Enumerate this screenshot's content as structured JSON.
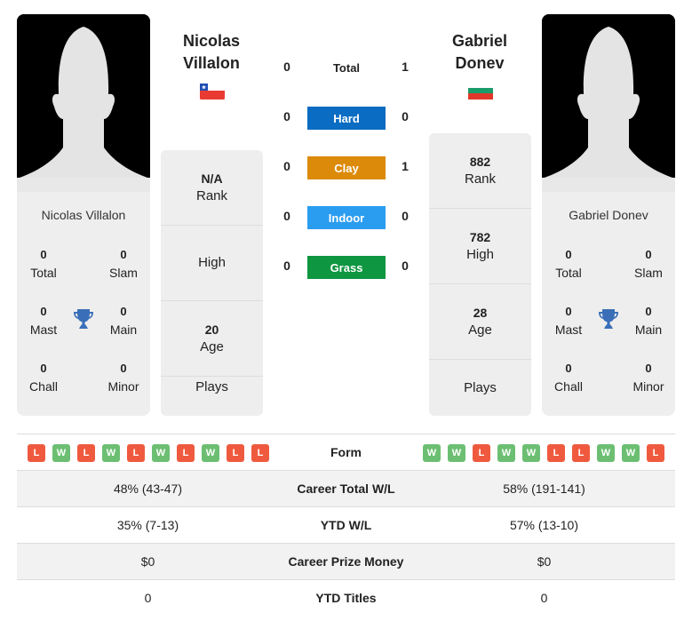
{
  "player1": {
    "name_line1": "Nicolas",
    "name_line2": "Villalon",
    "full_name": "Nicolas Villalon",
    "country": "Chile",
    "flag_icon": "chile-flag-icon",
    "titles": {
      "total": {
        "value": "0",
        "label": "Total"
      },
      "slam": {
        "value": "0",
        "label": "Slam"
      },
      "mast": {
        "value": "0",
        "label": "Mast"
      },
      "main": {
        "value": "0",
        "label": "Main"
      },
      "chall": {
        "value": "0",
        "label": "Chall"
      },
      "minor": {
        "value": "0",
        "label": "Minor"
      }
    },
    "info": {
      "rank": {
        "value": "N/A",
        "label": "Rank"
      },
      "high": {
        "value": "",
        "label": "High"
      },
      "age": {
        "value": "20",
        "label": "Age"
      },
      "plays": {
        "value": "",
        "label": "Plays"
      }
    },
    "form": [
      "L",
      "W",
      "L",
      "W",
      "L",
      "W",
      "L",
      "W",
      "L",
      "L"
    ]
  },
  "player2": {
    "name_line1": "Gabriel",
    "name_line2": "Donev",
    "full_name": "Gabriel Donev",
    "country": "Bulgaria",
    "flag_icon": "bulgaria-flag-icon",
    "titles": {
      "total": {
        "value": "0",
        "label": "Total"
      },
      "slam": {
        "value": "0",
        "label": "Slam"
      },
      "mast": {
        "value": "0",
        "label": "Mast"
      },
      "main": {
        "value": "0",
        "label": "Main"
      },
      "chall": {
        "value": "0",
        "label": "Chall"
      },
      "minor": {
        "value": "0",
        "label": "Minor"
      }
    },
    "info": {
      "rank": {
        "value": "882",
        "label": "Rank"
      },
      "high": {
        "value": "782",
        "label": "High"
      },
      "age": {
        "value": "28",
        "label": "Age"
      },
      "plays": {
        "value": "",
        "label": "Plays"
      }
    },
    "form": [
      "W",
      "W",
      "L",
      "W",
      "W",
      "L",
      "L",
      "W",
      "W",
      "L"
    ]
  },
  "h2h": {
    "total": {
      "label": "Total",
      "p1": "0",
      "p2": "1"
    },
    "surfaces": [
      {
        "label": "Hard",
        "p1": "0",
        "p2": "0",
        "color": "#0a6cc2"
      },
      {
        "label": "Clay",
        "p1": "0",
        "p2": "1",
        "color": "#dc8a0a"
      },
      {
        "label": "Indoor",
        "p1": "0",
        "p2": "0",
        "color": "#2b9df0"
      },
      {
        "label": "Grass",
        "p1": "0",
        "p2": "0",
        "color": "#0e9640"
      }
    ]
  },
  "form_label": "Form",
  "comparison": [
    {
      "label": "Career Total W/L",
      "p1": "48% (43-47)",
      "p2": "58% (191-141)"
    },
    {
      "label": "YTD W/L",
      "p1": "35% (7-13)",
      "p2": "57% (13-10)"
    },
    {
      "label": "Career Prize Money",
      "p1": "$0",
      "p2": "$0"
    },
    {
      "label": "YTD Titles",
      "p1": "0",
      "p2": "0"
    }
  ],
  "colors": {
    "win": "#6cbf72",
    "loss": "#ef5a3f",
    "trophy": "#3a6fb8"
  }
}
